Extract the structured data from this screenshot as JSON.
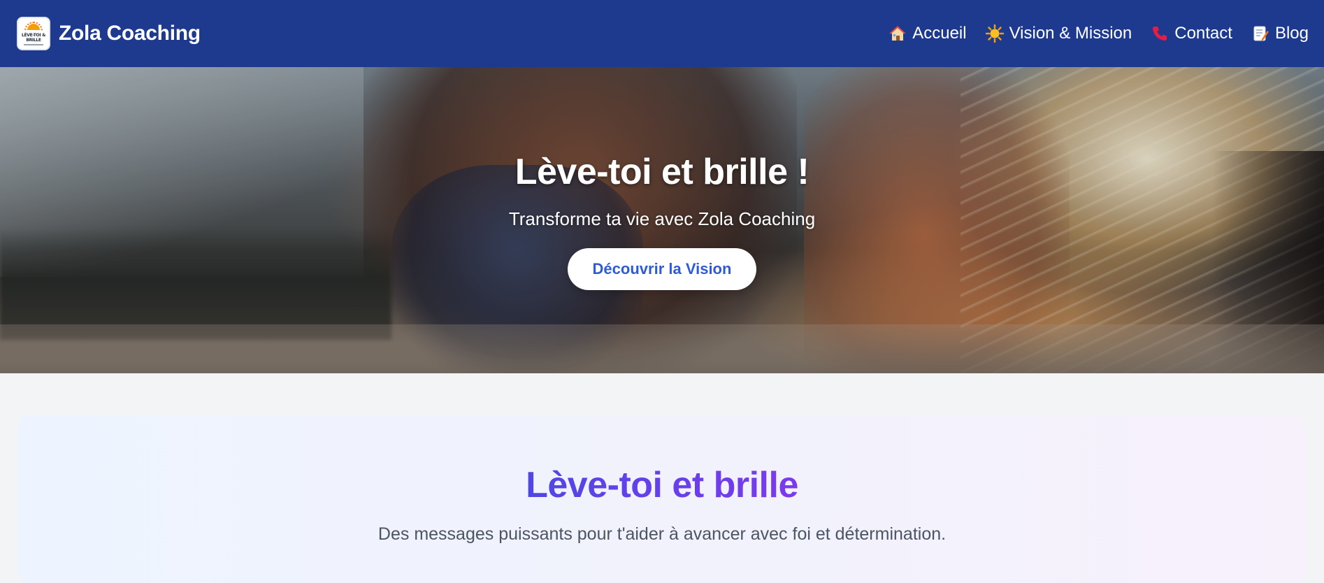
{
  "header": {
    "logo_text": "LÈVE-TOI & BRILLE",
    "brand_name": "Zola Coaching",
    "nav": [
      {
        "label": "Accueil",
        "icon": "house-icon"
      },
      {
        "label": "Vision & Mission",
        "icon": "sun-icon"
      },
      {
        "label": "Contact",
        "icon": "telephone-icon"
      },
      {
        "label": "Blog",
        "icon": "memo-icon"
      }
    ]
  },
  "hero": {
    "title": "Lève-toi et brille !",
    "subtitle": "Transforme ta vie avec Zola Coaching",
    "button_label": "Découvrir la Vision"
  },
  "section": {
    "title": "Lève-toi et brille",
    "text": "Des messages puissants pour t'aider à avancer avec foi et détermination."
  },
  "colors": {
    "navbar": "#1e3a8f",
    "button_text": "#2f5bd3",
    "section_title_start": "#4f46e5",
    "section_title_end": "#7c3aed",
    "page_background": "#f3f4f6"
  }
}
